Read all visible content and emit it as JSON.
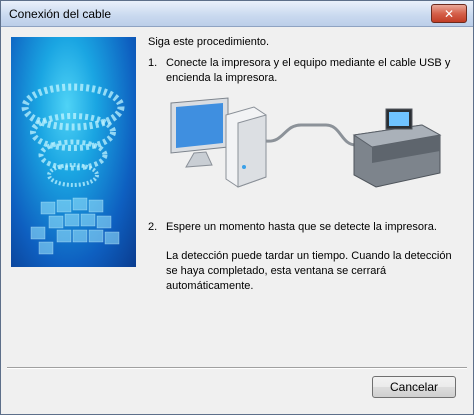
{
  "window": {
    "title": "Conexión del cable",
    "close_icon": "close-icon"
  },
  "content": {
    "intro": "Siga este procedimiento.",
    "step1_number": "1.",
    "step1_line1": "Conecte la impresora y el equipo mediante el cable USB y",
    "step1_line2": "encienda la impresora.",
    "step2_number": "2.",
    "step2_text": "Espere un momento hasta que se detecte la impresora.",
    "note_line1": "La detección puede tardar un tiempo. Cuando la detección",
    "note_line2": "se haya completado, esta ventana se cerrará",
    "note_line3": "automáticamente."
  },
  "buttons": {
    "cancel_label": "Cancelar"
  },
  "colors": {
    "title_bar": "#c9d9ef",
    "close_button": "#d5614b",
    "banner_blue": "#0e5fc0"
  }
}
